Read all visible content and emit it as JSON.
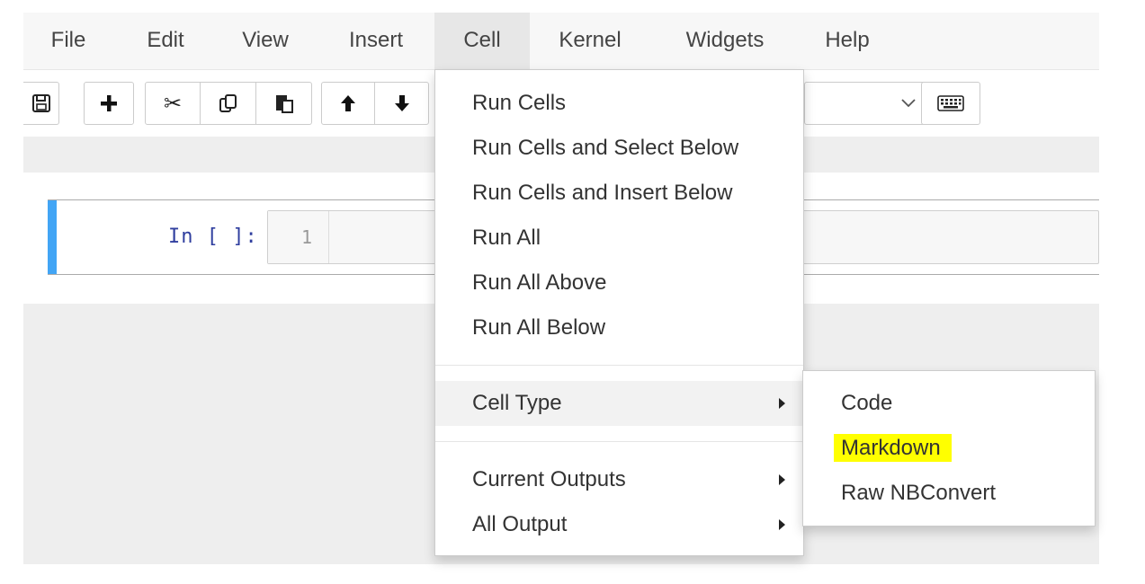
{
  "menubar": {
    "items": [
      {
        "label": "File"
      },
      {
        "label": "Edit"
      },
      {
        "label": "View"
      },
      {
        "label": "Insert"
      },
      {
        "label": "Cell"
      },
      {
        "label": "Kernel"
      },
      {
        "label": "Widgets"
      },
      {
        "label": "Help"
      }
    ],
    "active": "Cell"
  },
  "toolbar": {
    "buttons": [
      "save-icon",
      "plus-icon",
      "scissors-icon",
      "copy-icon",
      "paste-icon",
      "arrow-up-icon",
      "arrow-down-icon",
      "chevron-down-icon",
      "keyboard-icon"
    ],
    "cell_type_value": ""
  },
  "cell": {
    "prompt": "In [ ]:",
    "line_number": "1",
    "accent_color": "#42a5f5"
  },
  "cell_menu": {
    "items": [
      {
        "label": "Run Cells"
      },
      {
        "label": "Run Cells and Select Below"
      },
      {
        "label": "Run Cells and Insert Below"
      },
      {
        "label": "Run All"
      },
      {
        "label": "Run All Above"
      },
      {
        "label": "Run All Below"
      },
      {
        "label": "Cell Type"
      },
      {
        "label": "Current Outputs"
      },
      {
        "label": "All Output"
      }
    ]
  },
  "cell_type_submenu": {
    "items": [
      {
        "label": "Code"
      },
      {
        "label": "Markdown"
      },
      {
        "label": "Raw NBConvert"
      }
    ],
    "highlight_color": "#ffff00"
  }
}
